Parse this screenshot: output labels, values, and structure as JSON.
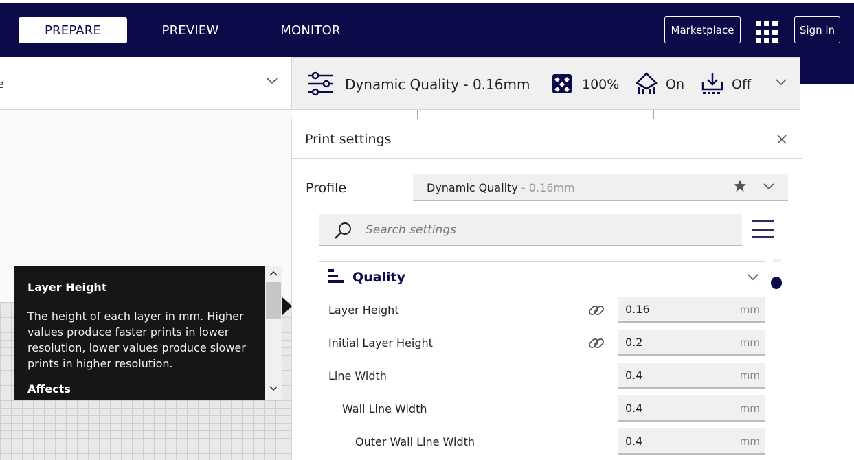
{
  "topbar": {
    "tabs": [
      {
        "label": "PREPARE",
        "active": true
      },
      {
        "label": "PREVIEW",
        "active": false
      },
      {
        "label": "MONITOR",
        "active": false
      }
    ],
    "marketplace_label": "Marketplace",
    "signin_label": "Sign in",
    "apps_icon": "grid-icon"
  },
  "left_selector": {
    "label": "e"
  },
  "settings_summary": {
    "profile": "Dynamic Quality - 0.16mm",
    "infill": "100%",
    "support": "On",
    "adhesion": "Off"
  },
  "print_settings": {
    "title": "Print settings",
    "profile_label": "Profile",
    "profile_name": "Dynamic Quality",
    "profile_sub": " - 0.16mm",
    "search_placeholder": "Search settings",
    "category": "Quality",
    "rows": [
      {
        "label": "Layer Height",
        "value": "0.16",
        "unit": "mm",
        "linked": true
      },
      {
        "label": "Initial Layer Height",
        "value": "0.2",
        "unit": "mm",
        "linked": true
      },
      {
        "label": "Line Width",
        "value": "0.4",
        "unit": "mm",
        "linked": false
      },
      {
        "label": "Wall Line Width",
        "value": "0.4",
        "unit": "mm",
        "linked": false
      },
      {
        "label": "Outer Wall Line Width",
        "value": "0.4",
        "unit": "mm",
        "linked": false
      }
    ]
  },
  "tooltip": {
    "title": "Layer Height",
    "body": "The height of each layer in mm. Higher values produce faster prints in lower resolution, lower values produce slower prints in higher resolution.",
    "affects": "Affects"
  },
  "colors": {
    "brand": "#0b0b4a",
    "panel_bg": "#f0f0f0",
    "tooltip_bg": "#161616"
  }
}
